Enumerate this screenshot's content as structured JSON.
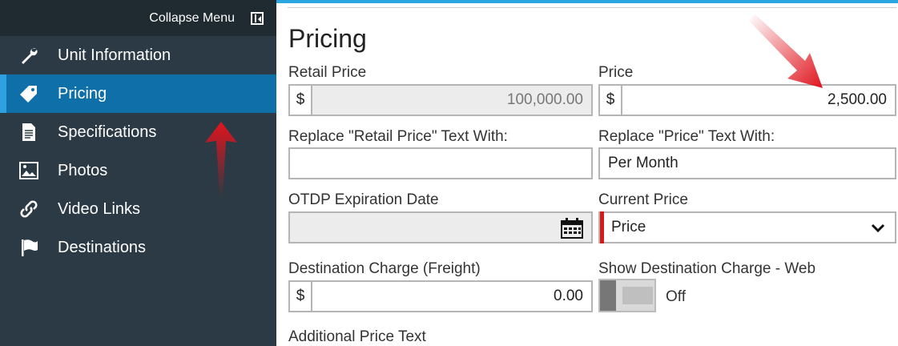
{
  "sidebar": {
    "collapse_label": "Collapse Menu",
    "items": [
      {
        "label": "Unit Information",
        "icon": "wrench-icon"
      },
      {
        "label": "Pricing",
        "icon": "tag-icon"
      },
      {
        "label": "Specifications",
        "icon": "document-icon"
      },
      {
        "label": "Photos",
        "icon": "image-icon"
      },
      {
        "label": "Video Links",
        "icon": "link-icon"
      },
      {
        "label": "Destinations",
        "icon": "flag-icon"
      }
    ],
    "active_item": "Pricing"
  },
  "main": {
    "title": "Pricing",
    "retail_price": {
      "label": "Retail Price",
      "prefix": "$",
      "value": "100,000.00"
    },
    "price": {
      "label": "Price",
      "prefix": "$",
      "value": "2,500.00"
    },
    "replace_retail": {
      "label": "Replace \"Retail Price\" Text With:",
      "value": ""
    },
    "replace_price": {
      "label": "Replace \"Price\" Text With:",
      "value": "Per Month"
    },
    "otdp": {
      "label": "OTDP Expiration Date",
      "value": ""
    },
    "current_price": {
      "label": "Current Price",
      "selected": "Price"
    },
    "destination_charge": {
      "label": "Destination Charge (Freight)",
      "prefix": "$",
      "value": "0.00"
    },
    "show_destination": {
      "label": "Show Destination Charge - Web",
      "state": "Off"
    },
    "additional_price_text": {
      "label": "Additional Price Text"
    }
  },
  "colors": {
    "sidebar_bg": "#2b3a44",
    "collapse_bg": "#1f2a31",
    "active_bg": "#0f6fa8",
    "accent": "#2aa7e0",
    "required_red": "#d41a1a",
    "annotation_arrow": "#e0141e"
  }
}
